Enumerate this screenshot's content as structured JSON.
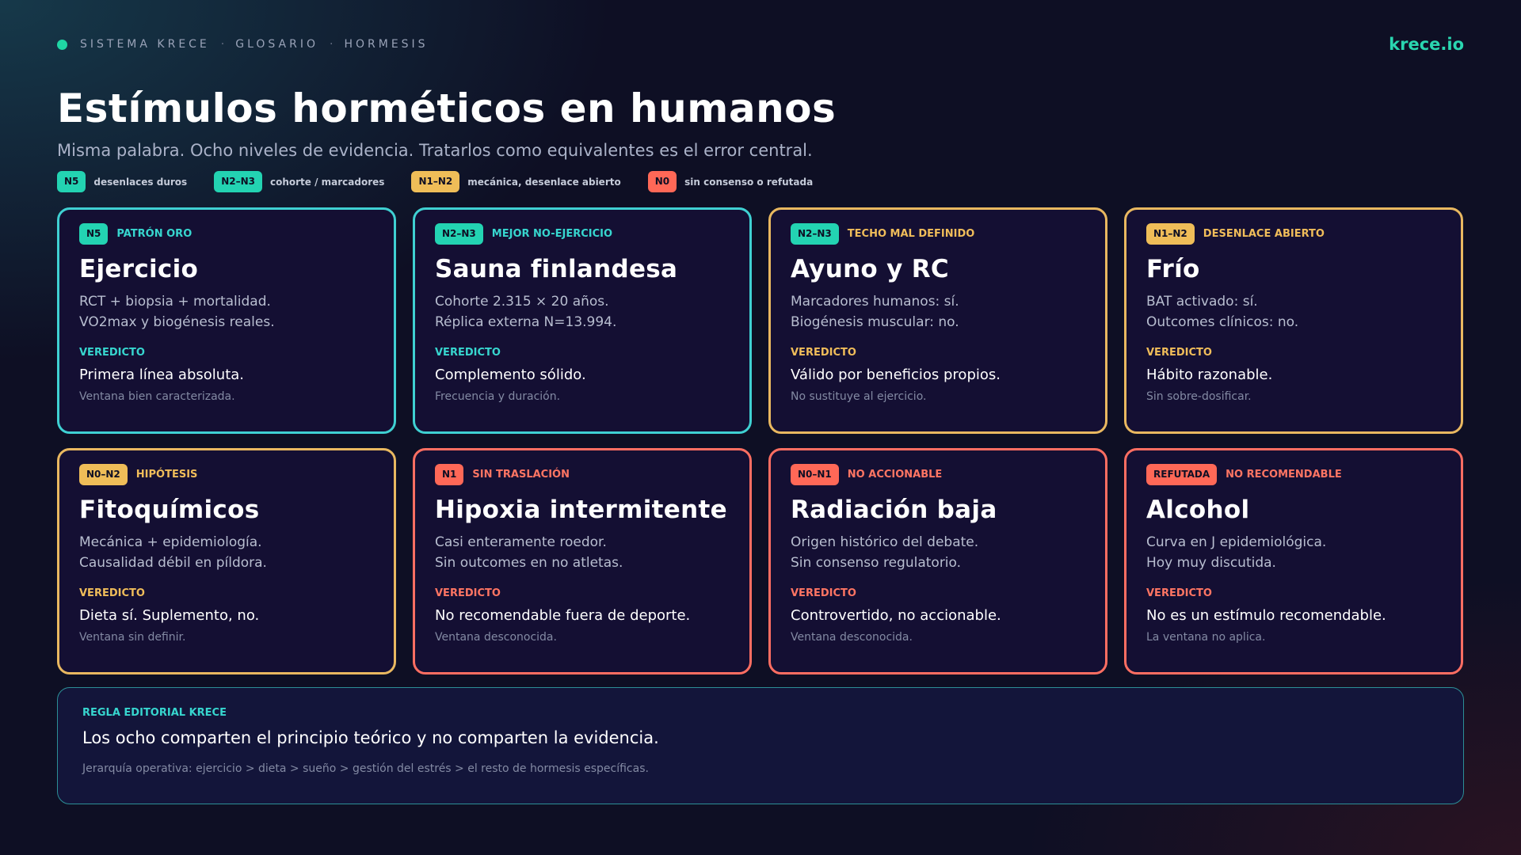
{
  "breadcrumb": [
    "SISTEMA KRECE",
    "GLOSARIO",
    "HORMESIS"
  ],
  "breadcrumb_separator": "·",
  "brand": "krece.io",
  "title": "Estímulos horméticos en humanos",
  "subtitle": "Misma palabra. Ocho niveles de evidencia. Tratarlos como equivalentes es el error central.",
  "legend": [
    {
      "badge": "N5",
      "label": "desenlaces duros",
      "color": "teal"
    },
    {
      "badge": "N2–N3",
      "label": "cohorte / marcadores",
      "color": "teal"
    },
    {
      "badge": "N1–N2",
      "label": "mecánica, desenlace abierto",
      "color": "amber"
    },
    {
      "badge": "N0",
      "label": "sin consenso o refutada",
      "color": "coral"
    }
  ],
  "colors": {
    "teal": "#3fd0d2",
    "amber": "#e9b860",
    "coral": "#ff6e62",
    "brand": "#2ad6b0"
  },
  "cards": [
    {
      "badge": "N5",
      "kicker": "PATRÓN ORO",
      "title": "Ejercicio",
      "lines": [
        "RCT + biopsia + mortalidad.",
        "VO2max y biogénesis reales."
      ],
      "verdict_label": "VEREDICTO",
      "verdict": "Primera línea absoluta.",
      "note": "Ventana bien caracterizada.",
      "color": "teal"
    },
    {
      "badge": "N2–N3",
      "kicker": "MEJOR NO-EJERCICIO",
      "title": "Sauna finlandesa",
      "lines": [
        "Cohorte 2.315 × 20 años.",
        "Réplica externa N=13.994."
      ],
      "verdict_label": "VEREDICTO",
      "verdict": "Complemento sólido.",
      "note": "Frecuencia y duración.",
      "color": "teal"
    },
    {
      "badge": "N2–N3",
      "kicker": "TECHO MAL DEFINIDO",
      "title": "Ayuno y RC",
      "lines": [
        "Marcadores humanos: sí.",
        "Biogénesis muscular: no."
      ],
      "verdict_label": "VEREDICTO",
      "verdict": "Válido por beneficios propios.",
      "note": "No sustituye al ejercicio.",
      "color": "amber"
    },
    {
      "badge": "N1–N2",
      "kicker": "DESENLACE ABIERTO",
      "title": "Frío",
      "lines": [
        "BAT activado: sí.",
        "Outcomes clínicos: no."
      ],
      "verdict_label": "VEREDICTO",
      "verdict": "Hábito razonable.",
      "note": "Sin sobre-dosificar.",
      "color": "amber"
    },
    {
      "badge": "N0–N2",
      "kicker": "HIPÓTESIS",
      "title": "Fitoquímicos",
      "lines": [
        "Mecánica + epidemiología.",
        "Causalidad débil en píldora."
      ],
      "verdict_label": "VEREDICTO",
      "verdict": "Dieta sí. Suplemento, no.",
      "note": "Ventana sin definir.",
      "color": "amber"
    },
    {
      "badge": "N1",
      "kicker": "SIN TRASLACIÓN",
      "title": "Hipoxia intermitente",
      "lines": [
        "Casi enteramente roedor.",
        "Sin outcomes en no atletas."
      ],
      "verdict_label": "VEREDICTO",
      "verdict": "No recomendable fuera de deporte.",
      "note": "Ventana desconocida.",
      "color": "coral"
    },
    {
      "badge": "N0–N1",
      "kicker": "NO ACCIONABLE",
      "title": "Radiación baja",
      "lines": [
        "Origen histórico del debate.",
        "Sin consenso regulatorio."
      ],
      "verdict_label": "VEREDICTO",
      "verdict": "Controvertido, no accionable.",
      "note": "Ventana desconocida.",
      "color": "coral"
    },
    {
      "badge": "REFUTADA",
      "kicker": "NO RECOMENDABLE",
      "title": "Alcohol",
      "lines": [
        "Curva en J epidemiológica.",
        "Hoy muy discutida."
      ],
      "verdict_label": "VEREDICTO",
      "verdict": "No es un estímulo recomendable.",
      "note": "La ventana no aplica.",
      "color": "coral"
    }
  ],
  "rule": {
    "label": "REGLA EDITORIAL KRECE",
    "text": "Los ocho comparten el principio teórico y no comparten la evidencia.",
    "footnote": "Jerarquía operativa: ejercicio > dieta > sueño > gestión del estrés > el resto de hormesis específicas."
  }
}
